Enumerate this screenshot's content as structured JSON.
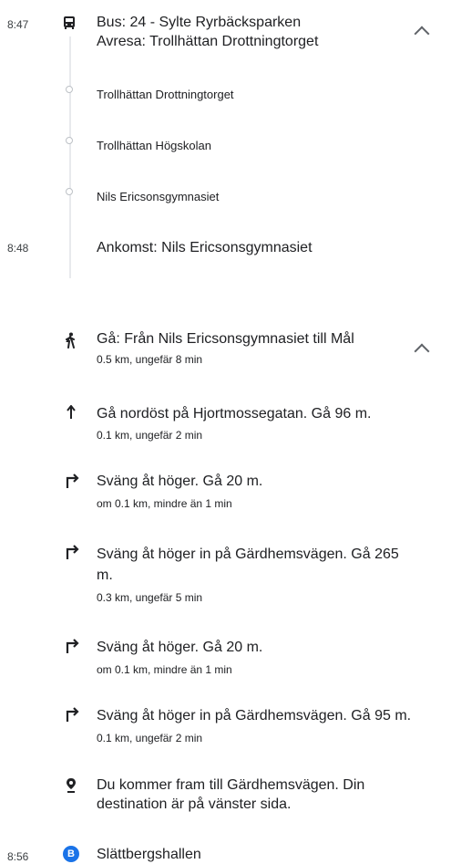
{
  "bus": {
    "time": "8:47",
    "title": "Bus: 24 - Sylte Ryrbäcksparken",
    "departure": "Avresa: Trollhättan Drottningtorget",
    "stops": [
      "Trollhättan Drottningtorget",
      "Trollhättan Högskolan",
      "Nils Ericsonsgymnasiet"
    ],
    "arrival_time": "8:48",
    "arrival": "Ankomst: Nils Ericsonsgymnasiet"
  },
  "walk": {
    "title": "Gå: Från Nils Ericsonsgymnasiet till Mål",
    "summary": "0.5 km, ungefär 8 min",
    "steps": [
      {
        "text": "Gå nordöst på Hjortmossegatan. Gå 96 m.",
        "detail": "0.1 km, ungefär 2 min",
        "icon": "arrow-up-icon"
      },
      {
        "text": "Sväng åt höger. Gå 20 m.",
        "detail": "om 0.1 km, mindre än 1 min",
        "icon": "turn-right-icon"
      },
      {
        "text": "Sväng åt höger in på Gärdhemsvägen. Gå 265",
        "text2": "m.",
        "detail": "0.3 km, ungefär 5 min",
        "icon": "turn-right-icon"
      },
      {
        "text": "Sväng åt höger. Gå 20 m.",
        "detail": "om 0.1 km, mindre än 1 min",
        "icon": "turn-right-icon"
      },
      {
        "text": "Sväng åt höger in på Gärdhemsvägen. Gå 95 m.",
        "detail": "0.1 km, ungefär 2 min",
        "icon": "turn-right-icon"
      }
    ],
    "arrive_line1": "Du kommer fram till Gärdhemsvägen. Din",
    "arrive_line2": "destination är på vänster sida."
  },
  "destination": {
    "time": "8:56",
    "badge": "B",
    "name": "Slättbergshallen"
  },
  "colors": {
    "badge": "#1a73e8",
    "line": "#e8eaed"
  }
}
